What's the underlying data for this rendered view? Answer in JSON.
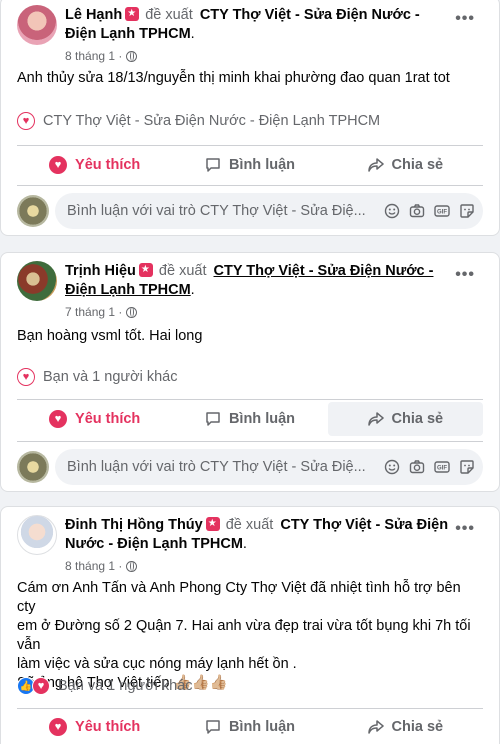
{
  "posts": [
    {
      "author": "Lê Hạnh",
      "verb": "đề xuất",
      "page": "CTY Thợ Việt - Sửa Điện Nước - Điện Lạnh TPHCM",
      "page_suffix": ".",
      "time": "8 tháng 1",
      "time_sep": "·",
      "text": "Anh thủy sửa 18/13/nguyễn thị minh khai phường đao quan 1rat tot",
      "reaction_text": "CTY Thợ Việt - Sửa Điện Nước - Điện Lạnh TPHCM",
      "like_label": "Yêu thích",
      "comment_label": "Bình luận",
      "share_label": "Chia sẻ",
      "comment_placeholder": "Bình luận với vai trò CTY Thợ Việt - Sửa Điệ..."
    },
    {
      "author": "Trịnh Hiệu",
      "verb": "đề xuất",
      "page": "CTY Thợ Việt - Sửa Điện Nước - Điện Lạnh TPHCM",
      "page_suffix": ".",
      "time": "7 tháng 1",
      "time_sep": "·",
      "text": "Bạn hoàng vsml tốt. Hai long",
      "reaction_text": "Bạn và 1 người khác",
      "like_label": "Yêu thích",
      "comment_label": "Bình luận",
      "share_label": "Chia sẻ",
      "comment_placeholder": "Bình luận với vai trò CTY Thợ Việt - Sửa Điệ..."
    },
    {
      "author": "Đinh Thị Hồng Thúy",
      "verb": "đề xuất",
      "page": "CTY Thợ Việt - Sửa Điện Nước - Điện Lạnh TPHCM",
      "page_suffix": ".",
      "time": "8 tháng 1",
      "time_sep": "·",
      "text_lines": [
        "Cám ơn Anh Tấn và Anh Phong Cty Thợ Việt đã nhiệt tình hỗ trợ bên cty",
        "em ở Đường số 2 Quận 7. Hai anh vừa đẹp trai vừa tốt bụng khi 7h tối vẫn",
        "làm việc và sửa cục nóng máy lạnh hết ồn .",
        "Sẽ ủng hộ Thợ Việt tiếp 👍🏼👍🏼👍🏼"
      ],
      "reaction_text": "Bạn và 1 người khác",
      "like_label": "Yêu thích",
      "comment_label": "Bình luận",
      "share_label": "Chia sẻ"
    }
  ],
  "colors": {
    "accent": "#e4325f",
    "muted": "#65676b",
    "bg": "#f0f2f5",
    "like_blue": "#1877f2"
  }
}
